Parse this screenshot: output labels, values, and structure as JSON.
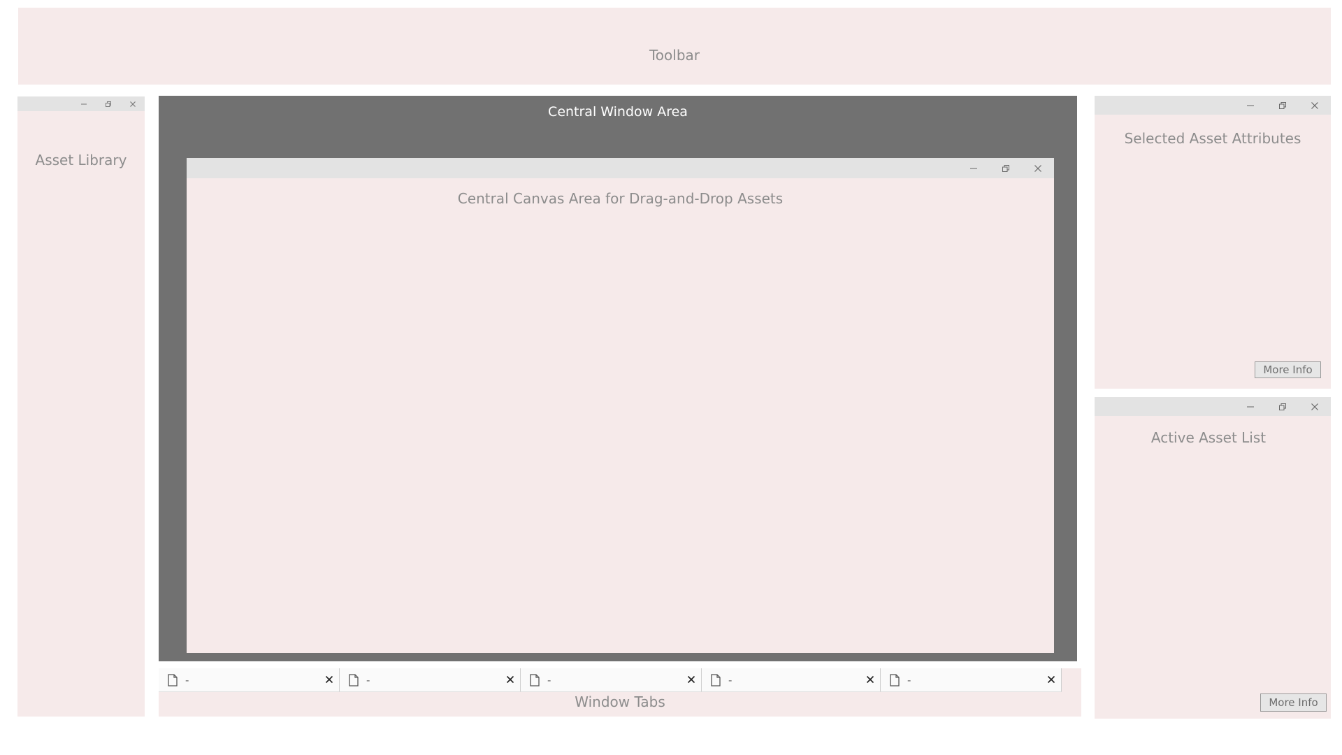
{
  "toolbar": {
    "label": "Toolbar"
  },
  "asset_library": {
    "label": "Asset Library"
  },
  "central_window": {
    "label": "Central Window Area",
    "canvas_label": "Central Canvas Area for Drag-and-Drop Assets"
  },
  "attributes_panel": {
    "label": "Selected Asset Attributes",
    "more_info": "More Info"
  },
  "active_list_panel": {
    "label": "Active Asset List",
    "more_info": "More Info"
  },
  "window_tabs": {
    "label": "Window Tabs",
    "tabs": [
      {
        "title": "-",
        "icon": "document-icon"
      },
      {
        "title": "-",
        "icon": "document-icon"
      },
      {
        "title": "-",
        "icon": "document-icon"
      },
      {
        "title": "-",
        "icon": "document-icon"
      },
      {
        "title": "-",
        "icon": "document-icon"
      }
    ]
  },
  "window_controls": [
    "minimize-icon",
    "restore-icon",
    "close-icon"
  ],
  "colors": {
    "panel_bg": "#f6eaea",
    "titlebar_bg": "#e3e3e3",
    "central_area_bg": "#717171",
    "label_text": "#8c8c8c"
  }
}
